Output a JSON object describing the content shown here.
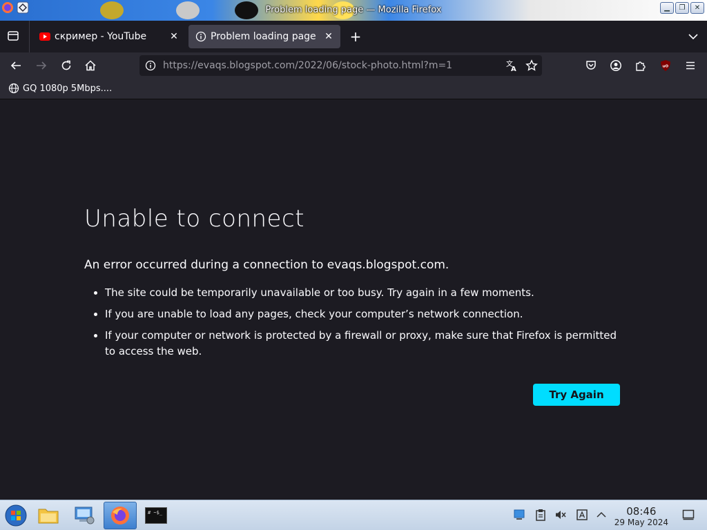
{
  "window": {
    "title": "Problem loading page — Mozilla Firefox",
    "controls": {
      "minimize": "▁",
      "maximize": "❐",
      "close": "✕"
    }
  },
  "tabs": [
    {
      "label": "скример - YouTube",
      "icon": "youtube-icon",
      "active": false
    },
    {
      "label": "Problem loading page",
      "icon": "info-icon",
      "active": true
    }
  ],
  "tab_controls": {
    "new_tab": "+",
    "list_tabs": "chevron-down-icon",
    "close": "✕"
  },
  "navbar": {
    "url_host_part": "https://evaqs.blogspot.com",
    "url_path_part": "/2022/06/stock-photo.html?m=1"
  },
  "bookmarks": [
    {
      "label": "GQ 1080p 5Mbps...."
    }
  ],
  "error_page": {
    "title": "Unable to connect",
    "message": "An error occurred during a connection to evaqs.blogspot.com.",
    "bullets": [
      "The site could be temporarily unavailable or too busy. Try again in a few moments.",
      "If you are unable to load any pages, check your computer’s network connection.",
      "If your computer or network is protected by a firewall or proxy, make sure that Firefox is permitted to access the web."
    ],
    "button_label": "Try Again"
  },
  "taskbar": {
    "time": "08:46",
    "date": "29 May 2024",
    "terminal_label": "# ~$_"
  },
  "colors": {
    "accent": "#00ddff",
    "content_bg": "#1c1b22",
    "toolbar_bg": "#2b2a33"
  }
}
